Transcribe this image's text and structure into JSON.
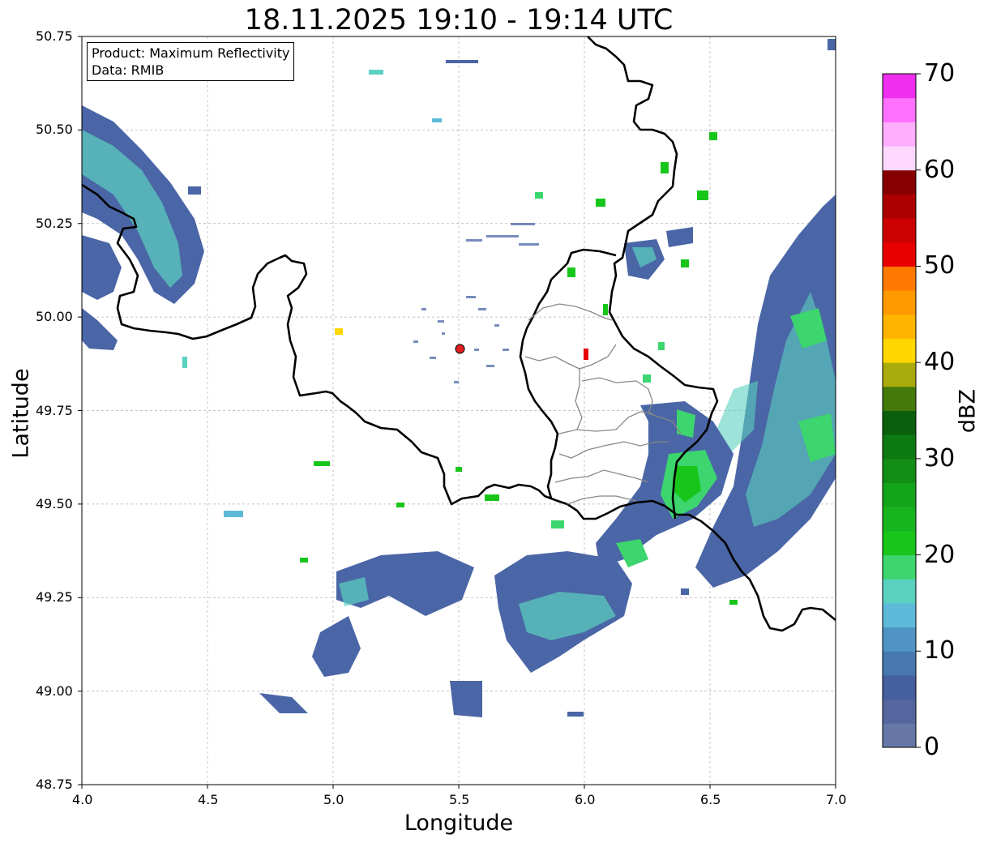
{
  "title": "18.11.2025 19:10 - 19:14 UTC",
  "info_box": {
    "product": "Product: Maximum Reflectivity",
    "data": "Data: RMIB"
  },
  "axes": {
    "xlabel": "Longitude",
    "ylabel": "Latitude",
    "xlim": [
      4.0,
      7.0
    ],
    "ylim": [
      48.75,
      50.75
    ],
    "xticks": [
      "4.0",
      "4.5",
      "5.0",
      "5.5",
      "6.0",
      "6.5",
      "7.0"
    ],
    "yticks": [
      "48.75",
      "49.00",
      "49.25",
      "49.50",
      "49.75",
      "50.00",
      "50.25",
      "50.50",
      "50.75"
    ],
    "grid": true
  },
  "radar_site": {
    "lon": 5.505,
    "lat": 49.915,
    "color": "#e02020"
  },
  "colorbar": {
    "label": "dBZ",
    "range": [
      0,
      70
    ],
    "ticks": [
      "0",
      "10",
      "20",
      "30",
      "40",
      "50",
      "60",
      "70"
    ],
    "colors": [
      "#6677a8",
      "#55669e",
      "#455f9f",
      "#4779b0",
      "#4f94c4",
      "#5db9d8",
      "#5bd1c0",
      "#3cd56e",
      "#18c61b",
      "#17b51d",
      "#14a41a",
      "#128e16",
      "#0e7a12",
      "#095f0b",
      "#457a0b",
      "#a9aa0b",
      "#ffd600",
      "#ffb400",
      "#ff9900",
      "#ff7a00",
      "#e80000",
      "#cc0000",
      "#ac0000",
      "#860000",
      "#ffd8ff",
      "#ffadff",
      "#ff70ff",
      "#ee30ee"
    ]
  }
}
